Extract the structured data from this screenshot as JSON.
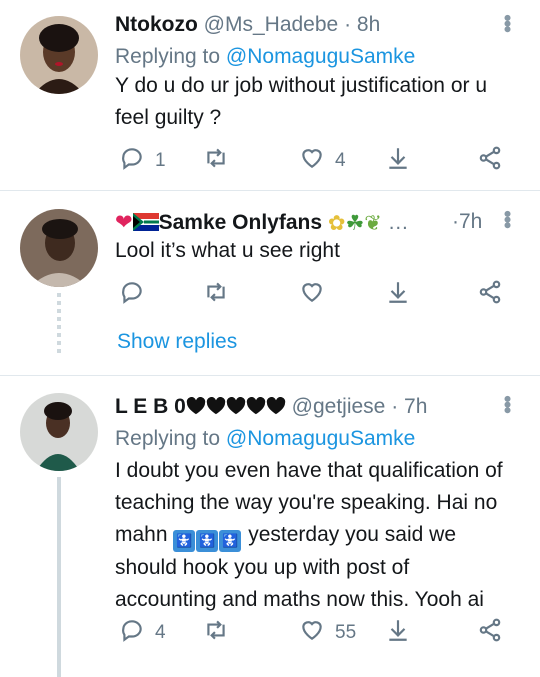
{
  "tweets": [
    {
      "name": "Ntokozo",
      "handle": "@Ms_Hadebe",
      "dot": "·",
      "time": "8h",
      "replying_prefix": "Replying to",
      "replying_to": "@NomaguguSamke",
      "body_lines": [
        "Y do u do ur job without justification or u",
        "feel guilty ?"
      ],
      "reply_count": "1",
      "retweet_count": "",
      "like_count": "4"
    },
    {
      "name": "Samke Onlyfans",
      "name_suffix": "…",
      "dot": "·",
      "time": "7h",
      "body_lines": [
        "Lool it’s what u see right"
      ],
      "reply_count": "",
      "retweet_count": "",
      "like_count": "",
      "show_replies": "Show replies"
    },
    {
      "name": "L E B 0",
      "handle": "@getjiese",
      "dot": "·",
      "time": "7h",
      "replying_prefix": "Replying to",
      "replying_to": "@NomaguguSamke",
      "body_lines": [
        "I doubt you even have that qualification of",
        "teaching the way you're speaking. Hai no",
        "mahn",
        "yesterday you said we",
        "should hook you up with post of",
        "accounting and maths now this. Yooh ai"
      ],
      "reply_count": "4",
      "retweet_count": "",
      "like_count": "55"
    }
  ],
  "icons": {
    "reply": "reply-icon",
    "retweet": "retweet-icon",
    "like": "heart-icon",
    "download": "download-icon",
    "share": "share-icon",
    "more": "more-vertical-icon"
  },
  "colors": {
    "link": "#1b95e0",
    "muted": "#657786",
    "text": "#14171a",
    "divider": "#e1e8ed"
  }
}
